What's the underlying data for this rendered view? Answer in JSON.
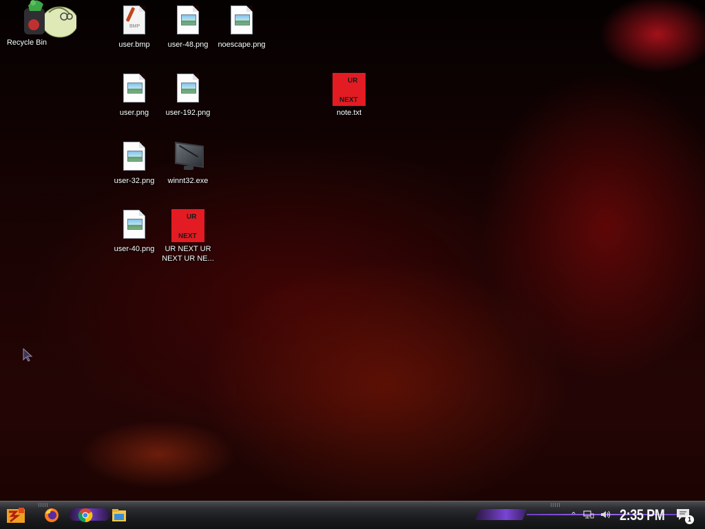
{
  "desktop": {
    "icons": [
      {
        "label": "Recycle Bin",
        "icon": "recycle-bin-icon"
      },
      {
        "label": "user.bmp",
        "icon": "bmp-file-icon",
        "tag": "BMP"
      },
      {
        "label": "user-48.png",
        "icon": "png-file-icon"
      },
      {
        "label": "noescape.png",
        "icon": "png-file-icon"
      },
      {
        "label": "user.png",
        "icon": "png-file-icon"
      },
      {
        "label": "user-192.png",
        "icon": "png-file-icon"
      },
      {
        "label": "note.txt",
        "icon": "red-note-icon",
        "text_top": "UR",
        "text_bottom": "NEXT"
      },
      {
        "label": "user-32.png",
        "icon": "png-file-icon"
      },
      {
        "label": "winnt32.exe",
        "icon": "monitor-icon"
      },
      {
        "label": "user-40.png",
        "icon": "png-file-icon"
      },
      {
        "label": "UR NEXT UR NEXT UR NE...",
        "icon": "red-note-icon",
        "text_top": "UR",
        "text_bottom": "NEXT"
      }
    ]
  },
  "taskbar": {
    "start": {
      "icon": "start-icon"
    },
    "pinned": [
      {
        "name": "firefox",
        "icon": "firefox-icon"
      },
      {
        "name": "chrome",
        "icon": "chrome-icon"
      },
      {
        "name": "file-explorer",
        "icon": "folder-icon"
      }
    ],
    "tray": {
      "icons": [
        "chevron-up-icon",
        "network-icon",
        "volume-icon"
      ],
      "clock": "2:35 PM",
      "notifications_count": "1"
    }
  },
  "colors": {
    "accent": "#7a45d4",
    "note_red": "#e31b23"
  }
}
